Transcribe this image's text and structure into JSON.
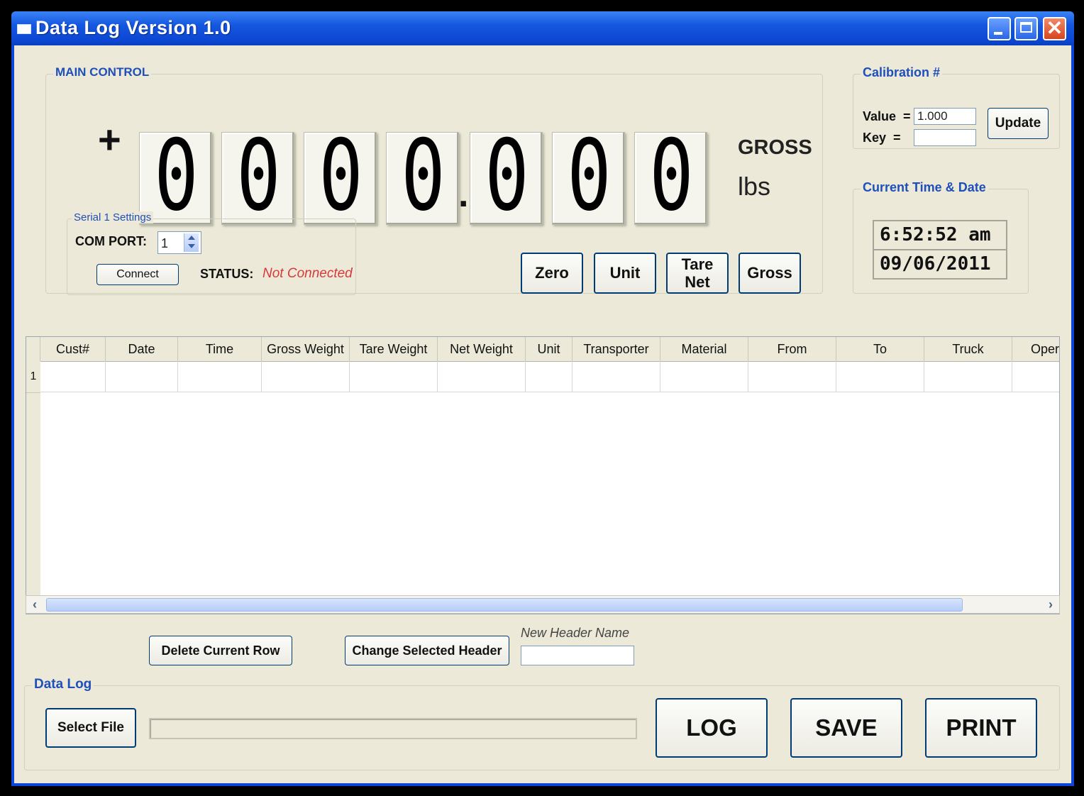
{
  "window": {
    "title": "Data Log Version 1.0",
    "close_glyph": "✕"
  },
  "main_control": {
    "legend": "MAIN CONTROL",
    "sign": "+",
    "digits": [
      "0",
      "0",
      "0",
      "0",
      "0",
      "0",
      "0"
    ],
    "decimal_point": ".",
    "mode": "GROSS",
    "unit": "lbs",
    "buttons": {
      "zero": "Zero",
      "unit": "Unit",
      "tare": "Tare",
      "net": "Net",
      "gross": "Gross"
    }
  },
  "serial": {
    "legend": "Serial 1 Settings",
    "com_port_label": "COM PORT:",
    "com_port_value": "1",
    "connect_label": "Connect",
    "status_label": "STATUS:",
    "status_value": "Not Connected",
    "status_color": "#d63a3a"
  },
  "calibration": {
    "legend": "Calibration #",
    "value_label": "Value  =",
    "value": "1.000",
    "key_label": "Key  =",
    "key": "",
    "update_label": "Update"
  },
  "time_date": {
    "legend": "Current Time & Date",
    "time": "6:52:52 am",
    "date": "09/06/2011"
  },
  "table": {
    "columns": [
      "Cust#",
      "Date",
      "Time",
      "Gross Weight",
      "Tare Weight",
      "Net Weight",
      "Unit",
      "Transporter",
      "Material",
      "From",
      "To",
      "Truck",
      "Operator"
    ],
    "rows": [
      {
        "index": "1"
      }
    ]
  },
  "header_edit": {
    "delete_row_label": "Delete Current Row",
    "change_header_label": "Change Selected Header",
    "new_header_caption": "New Header Name",
    "new_header_value": ""
  },
  "data_log": {
    "legend": "Data Log",
    "select_file_label": "Select File",
    "log_label": "LOG",
    "save_label": "SAVE",
    "print_label": "PRINT"
  },
  "colors": {
    "accent": "#1f4fb8",
    "titlebar": "#0c47d2",
    "panel": "#ece9d8"
  }
}
